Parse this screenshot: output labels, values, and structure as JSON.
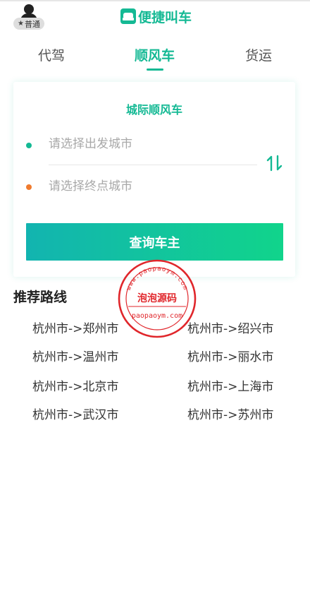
{
  "header": {
    "badge_label": "普通",
    "app_name": "便捷叫车"
  },
  "tabs": [
    {
      "label": "代驾"
    },
    {
      "label": "顺风车"
    },
    {
      "label": "货运"
    }
  ],
  "card": {
    "title": "城际顺风车",
    "from_placeholder": "请选择出发城市",
    "to_placeholder": "请选择终点城市",
    "query_button": "查询车主"
  },
  "recommended": {
    "title": "推荐路线",
    "routes": [
      "杭州市->郑州市",
      "杭州市->绍兴市",
      "杭州市->温州市",
      "杭州市->丽水市",
      "杭州市->北京市",
      "杭州市->上海市",
      "杭州市->武汉市",
      "杭州市->苏州市"
    ]
  },
  "watermark": {
    "top_text": "www.paopaoym.com",
    "center_text": "泡泡源码",
    "bottom_text": "paopaoym.com"
  },
  "colors": {
    "brand": "#14b994",
    "orange_dot": "#f07b2e",
    "stamp_red": "#e0262b"
  },
  "icons": {
    "user": "user-icon",
    "star": "star-icon",
    "logo": "car-logo-icon",
    "swap": "swap-arrows-icon"
  }
}
